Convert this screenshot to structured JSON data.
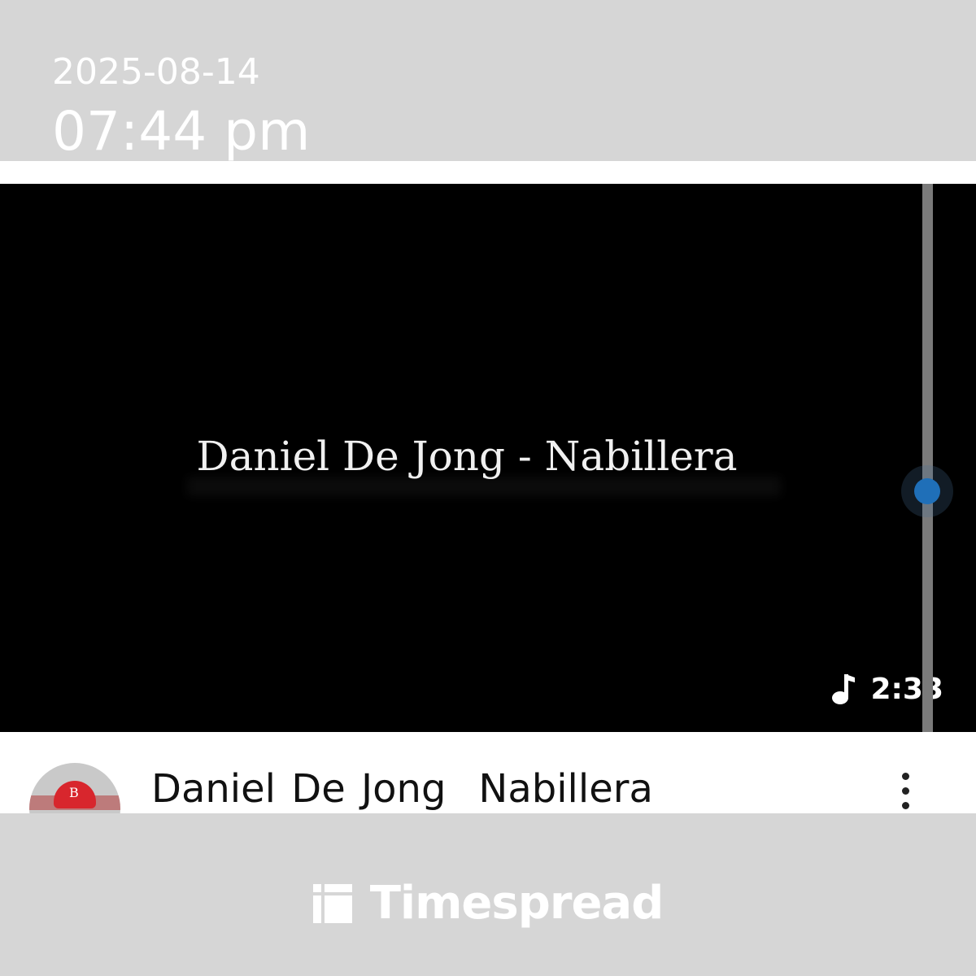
{
  "header": {
    "date": "2025-08-14",
    "time": "07:44 pm"
  },
  "video": {
    "title_card": "Daniel De Jong - Nabillera",
    "duration": "2:33",
    "icon": "music-note-icon"
  },
  "info": {
    "title_part1": "Daniel De Jong",
    "title_part2": "Nabillera",
    "avatar_cap_letter": "B",
    "more_icon": "more-vertical-icon"
  },
  "brand": {
    "name": "Timespread",
    "icon": "timespread-logo-icon"
  },
  "colors": {
    "background": "#d6d6d6",
    "video_bg": "#000000",
    "scroll_thumb": "#1f6fb8"
  }
}
